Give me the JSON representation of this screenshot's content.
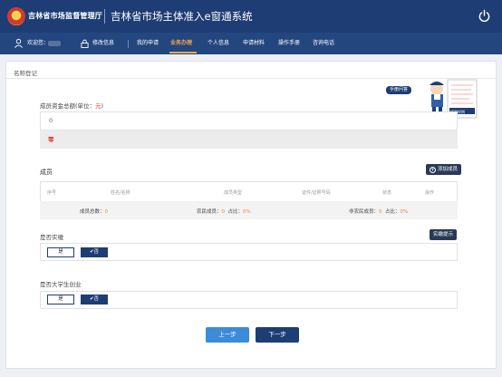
{
  "header": {
    "org_name": "吉林省市场监督管理厅",
    "system_title": "吉林省市场主体准入e窗通系统"
  },
  "nav": {
    "welcome": "欢迎您：",
    "items": [
      "修改信息",
      "我的申请",
      "业务办理",
      "个人信息",
      "申请材料",
      "操作手册",
      "咨询电话"
    ],
    "active": "业务办理"
  },
  "card": {
    "title": "名称登记",
    "mascot_bubble": "手册问答",
    "mascot_tag": "填写样例"
  },
  "capital": {
    "label_prefix": "成员资金总额(单位：",
    "label_unit": "元",
    "label_suffix": ")",
    "value": "0",
    "uppercase": "零"
  },
  "members": {
    "title": "成员",
    "add_button": "添加成员",
    "columns": [
      "序号",
      "姓名/名称",
      "成员类型",
      "证件/证照号码",
      "状态",
      "操作"
    ],
    "total_label": "成员总数：",
    "total_value": "0",
    "farmer_label": "农民成员：",
    "farmer_value": "0",
    "farmer_ratio_label": "占比：",
    "farmer_ratio_value": "0%",
    "nonfarmer_label": "非农民成员：",
    "nonfarmer_value": "0",
    "nonfarmer_ratio_label": "占比：",
    "nonfarmer_ratio_value": "0%"
  },
  "demo": {
    "question": "是否实缴",
    "hint_button": "实缴提示",
    "yes": "是",
    "no": "✔否",
    "selected": "否"
  },
  "graduate": {
    "question": "是否大学生创业",
    "yes": "是",
    "no": "✔否",
    "selected": "否"
  },
  "footer": {
    "prev": "上一步",
    "next": "下一步"
  }
}
